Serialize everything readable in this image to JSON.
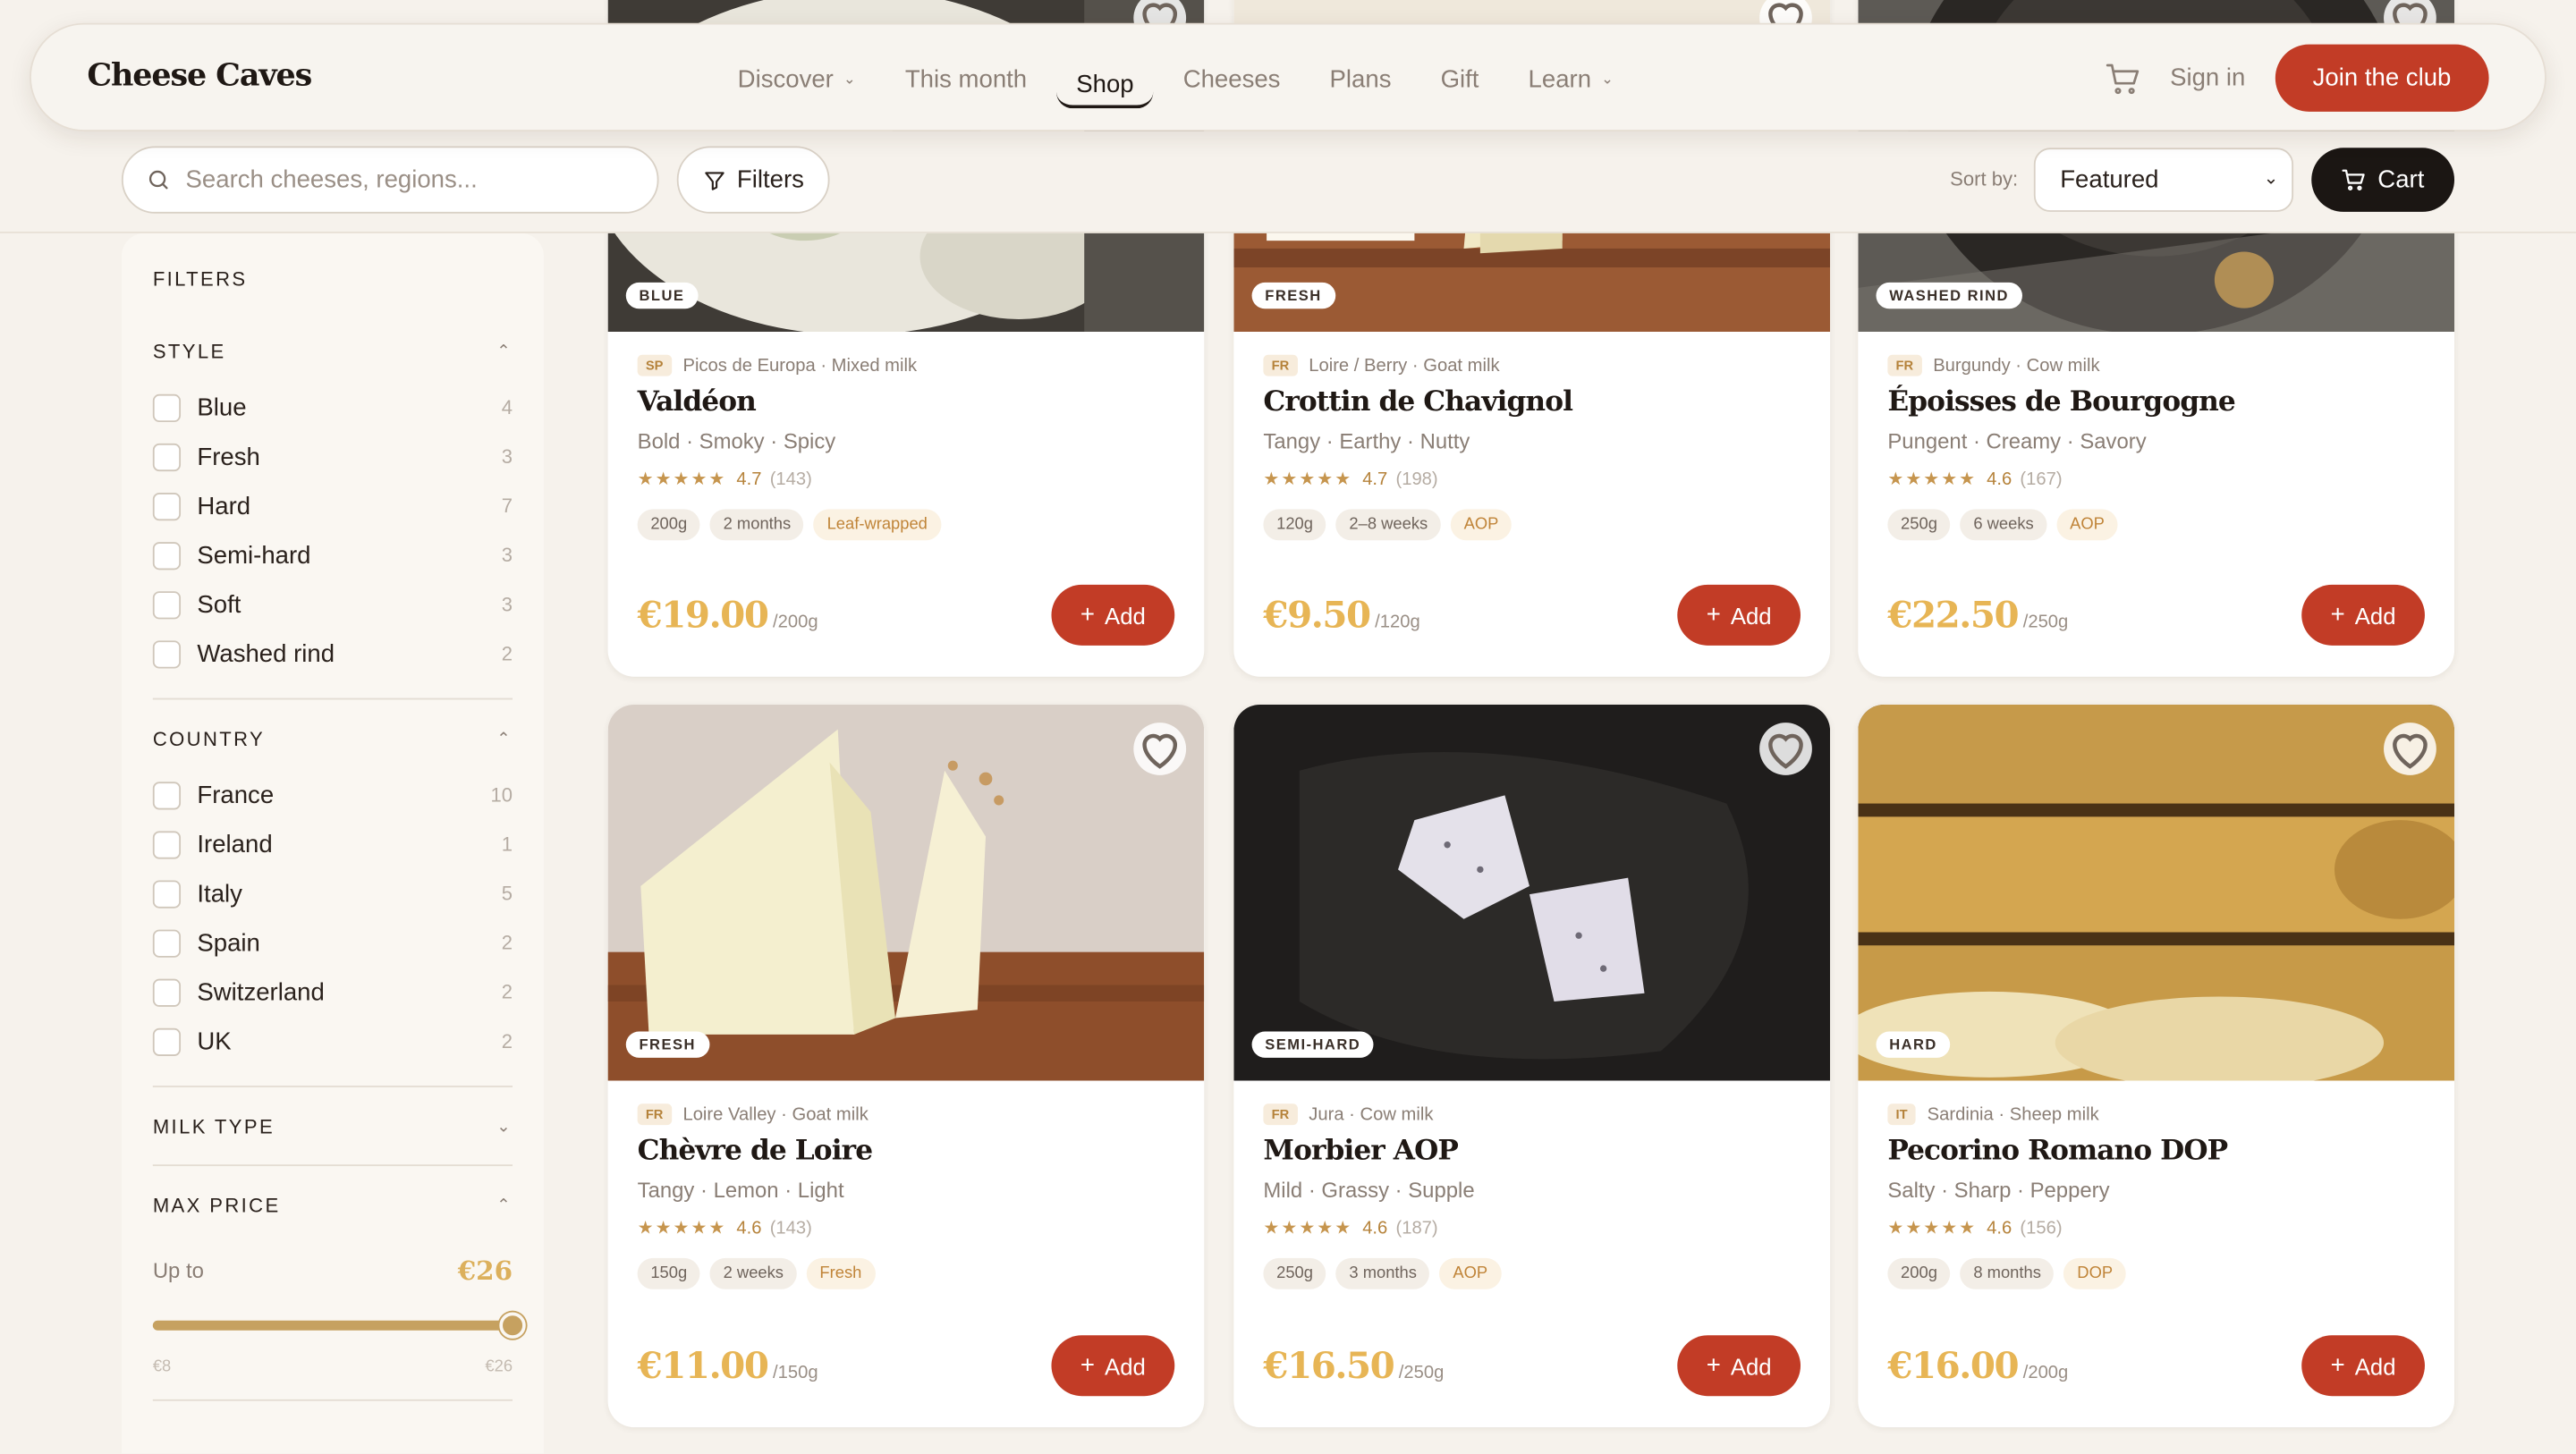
{
  "brand": "Cheese Caves",
  "nav": {
    "links": [
      {
        "label": "Discover",
        "dropdown": true
      },
      {
        "label": "This month",
        "dropdown": false
      },
      {
        "label": "Shop",
        "dropdown": false,
        "active": true
      },
      {
        "label": "Cheeses",
        "dropdown": false
      },
      {
        "label": "Plans",
        "dropdown": false
      },
      {
        "label": "Gift",
        "dropdown": false
      },
      {
        "label": "Learn",
        "dropdown": true
      }
    ],
    "signin": "Sign in",
    "join": "Join the club"
  },
  "toolbar": {
    "search_placeholder": "Search cheeses, regions...",
    "filters_label": "Filters",
    "sortby_label": "Sort by:",
    "sort_value": "Featured",
    "cart_label": "Cart"
  },
  "sidebar": {
    "title": "FILTERS",
    "style": {
      "heading": "STYLE",
      "options": [
        {
          "label": "Blue",
          "count": "4"
        },
        {
          "label": "Fresh",
          "count": "3"
        },
        {
          "label": "Hard",
          "count": "7"
        },
        {
          "label": "Semi-hard",
          "count": "3"
        },
        {
          "label": "Soft",
          "count": "3"
        },
        {
          "label": "Washed rind",
          "count": "2"
        }
      ]
    },
    "country": {
      "heading": "COUNTRY",
      "options": [
        {
          "label": "France",
          "count": "10"
        },
        {
          "label": "Ireland",
          "count": "1"
        },
        {
          "label": "Italy",
          "count": "5"
        },
        {
          "label": "Spain",
          "count": "2"
        },
        {
          "label": "Switzerland",
          "count": "2"
        },
        {
          "label": "UK",
          "count": "2"
        }
      ]
    },
    "milk": {
      "heading": "MILK TYPE"
    },
    "price": {
      "heading": "MAX PRICE",
      "upto_label": "Up to",
      "value": "€26",
      "min": "€8",
      "max": "€26",
      "fill_fraction": 1.0
    }
  },
  "colors": {
    "accent": "#c23c26",
    "gold": "#e7b555",
    "background": "#f6f2ec"
  },
  "products": [
    {
      "badge": "BLUE",
      "cc": "SP",
      "origin": "Picos de Europa · Mixed milk",
      "name": "Valdéon",
      "notes": "Bold · Smoky · Spicy",
      "rating": "4.7",
      "reviews": "(143)",
      "tags": [
        "200g",
        "2 months"
      ],
      "accent_tag": "Leaf-wrapped",
      "price": "€19.00",
      "unit": "/200g",
      "add": "Add",
      "photo": "blue"
    },
    {
      "badge": "FRESH",
      "cc": "FR",
      "origin": "Loire / Berry · Goat milk",
      "name": "Crottin de Chavignol",
      "notes": "Tangy · Earthy · Nutty",
      "rating": "4.7",
      "reviews": "(198)",
      "tags": [
        "120g",
        "2–8 weeks"
      ],
      "accent_tag": "AOP",
      "price": "€9.50",
      "unit": "/120g",
      "add": "Add",
      "photo": "crottin"
    },
    {
      "badge": "WASHED RIND",
      "cc": "FR",
      "origin": "Burgundy · Cow milk",
      "name": "Époisses de Bourgogne",
      "notes": "Pungent · Creamy · Savory",
      "rating": "4.6",
      "reviews": "(167)",
      "tags": [
        "250g",
        "6 weeks"
      ],
      "accent_tag": "AOP",
      "price": "€22.50",
      "unit": "/250g",
      "add": "Add",
      "photo": "epoisses"
    },
    {
      "badge": "FRESH",
      "cc": "FR",
      "origin": "Loire Valley · Goat milk",
      "name": "Chèvre de Loire",
      "notes": "Tangy · Lemon · Light",
      "rating": "4.6",
      "reviews": "(143)",
      "tags": [
        "150g",
        "2 weeks"
      ],
      "accent_tag": "Fresh",
      "price": "€11.00",
      "unit": "/150g",
      "add": "Add",
      "photo": "chevre"
    },
    {
      "badge": "SEMI-HARD",
      "cc": "FR",
      "origin": "Jura · Cow milk",
      "name": "Morbier AOP",
      "notes": "Mild · Grassy · Supple",
      "rating": "4.6",
      "reviews": "(187)",
      "tags": [
        "250g",
        "3 months"
      ],
      "accent_tag": "AOP",
      "price": "€16.50",
      "unit": "/250g",
      "add": "Add",
      "photo": "morbier"
    },
    {
      "badge": "HARD",
      "cc": "IT",
      "origin": "Sardinia · Sheep milk",
      "name": "Pecorino Romano DOP",
      "notes": "Salty · Sharp · Peppery",
      "rating": "4.6",
      "reviews": "(156)",
      "tags": [
        "200g",
        "8 months"
      ],
      "accent_tag": "DOP",
      "price": "€16.00",
      "unit": "/200g",
      "add": "Add",
      "photo": "pecorino"
    }
  ]
}
